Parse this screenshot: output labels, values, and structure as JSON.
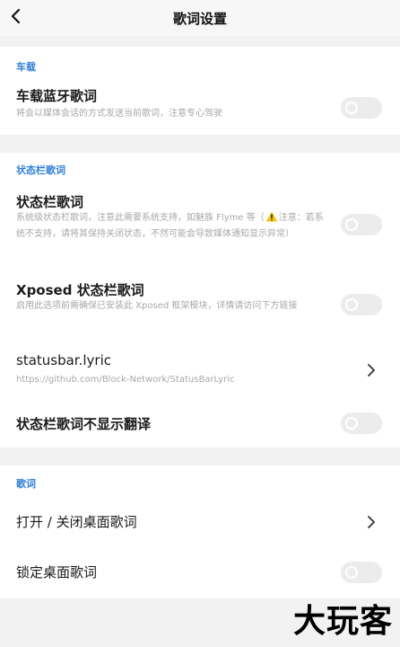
{
  "header": {
    "title": "歌词设置",
    "back_icon": "chevron-left-icon"
  },
  "car": {
    "section_title": "车载",
    "bluetooth_title": "车载蓝牙歌词",
    "bluetooth_desc": "将会以媒体会话的方式发送当前歌词，注意专心驾驶",
    "bluetooth_enabled": false
  },
  "statusbar": {
    "section_title": "状态栏歌词",
    "lyric_title": "状态栏歌词",
    "lyric_desc_part1": "系统级状态栏歌词，注意此需要系统支持，如魅族 Flyme 等（",
    "lyric_desc_part2": "注意：若系统不支持，请将其保持关闭状态，不然可能会导致媒体通知显示异常）",
    "lyric_enabled": false,
    "xposed_title": "Xposed 状态栏歌词",
    "xposed_desc": "启用此选项前需确保已安装此 Xposed 框架模块，详情请访问下方链接",
    "xposed_enabled": false,
    "link_title": "statusbar.lyric",
    "link_url": "https://github.com/Block-Network/StatusBarLyric",
    "no_translate_title": "状态栏歌词不显示翻译",
    "no_translate_enabled": false
  },
  "lyrics": {
    "section_title": "歌词",
    "desktop_toggle_title": "打开 / 关闭桌面歌词",
    "lock_title": "锁定桌面歌词",
    "lock_enabled": false
  },
  "watermark": "大玩客",
  "colors": {
    "accent": "#2f7fd8",
    "background": "#f2f2f2",
    "toggle_off": "#ececec",
    "warning": "#f5c518"
  }
}
